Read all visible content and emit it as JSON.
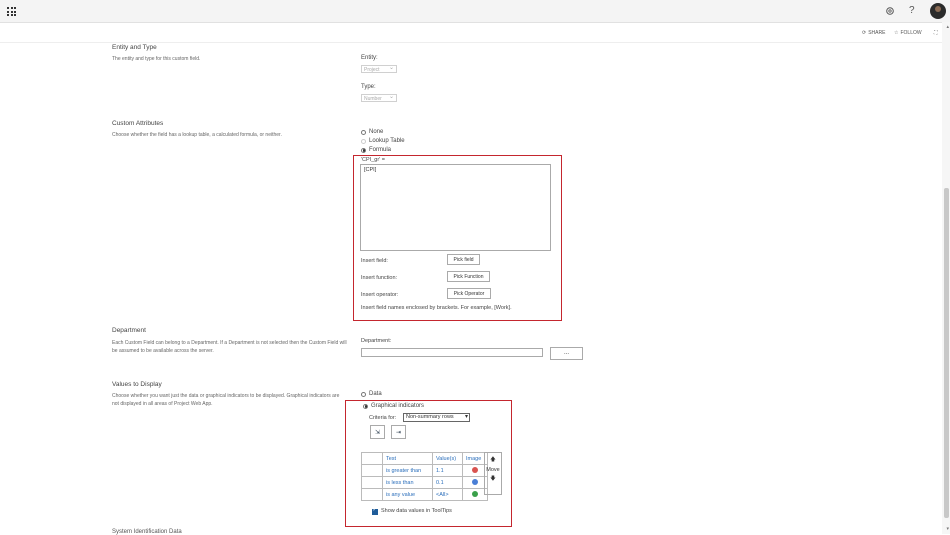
{
  "topbar": {
    "help_label": "?"
  },
  "commandbar": {
    "share_label": "SHARE",
    "follow_label": "FOLLOW"
  },
  "entity_type": {
    "title": "Entity and Type",
    "description": "The entity and type for this custom field.",
    "entity_label": "Entity:",
    "entity_value": "Project",
    "type_label": "Type:",
    "type_value": "Number"
  },
  "custom_attributes": {
    "title": "Custom Attributes",
    "description": "Choose whether the field has a lookup table, a calculated formula, or neither.",
    "options": [
      "None",
      "Lookup Table",
      "Formula"
    ],
    "selected": "Formula",
    "formula_header": "'CPI_gr' =",
    "formula_text": "[CPI]",
    "insert_field_label": "Insert field:",
    "insert_field_button": "Pick field",
    "insert_function_label": "Insert function:",
    "insert_function_button": "Pick Function",
    "insert_operator_label": "Insert operator:",
    "insert_operator_button": "Pick Operator",
    "hint": "Insert field names enclosed by brackets. For example, [Work]."
  },
  "department": {
    "title": "Department",
    "description": "Each Custom Field can belong to a Department. If a Department is not selected then the Custom Field will be assumed to be available across the server.",
    "label": "Department:",
    "value": "",
    "browse_button": "..."
  },
  "values_to_display": {
    "title": "Values to Display",
    "description": "Choose whether you want just the data or graphical indicators to be displayed. Graphical indicators are not displayed in all areas of Project Web App.",
    "options": [
      "Data",
      "Graphical indicators"
    ],
    "selected": "Graphical indicators",
    "criteria_label": "Criteria for:",
    "criteria_value": "Non-summary rows",
    "table_headers": [
      "Test",
      "Value(s)",
      "Image"
    ],
    "rows": [
      {
        "test": "is greater than",
        "value": "1.1",
        "image_color": "#d9534f"
      },
      {
        "test": "is less than",
        "value": "0.1",
        "image_color": "#4a7fd6"
      },
      {
        "test": "is any value",
        "value": "<All>",
        "image_color": "#3aa04a"
      }
    ],
    "move_label": "Move",
    "show_tooltips_label": "Show data values in ToolTips",
    "show_tooltips_checked": true
  },
  "next_section_title": "System Identification Data",
  "colors": {
    "highlight": "#c4262e",
    "link": "#2a6ebb"
  }
}
